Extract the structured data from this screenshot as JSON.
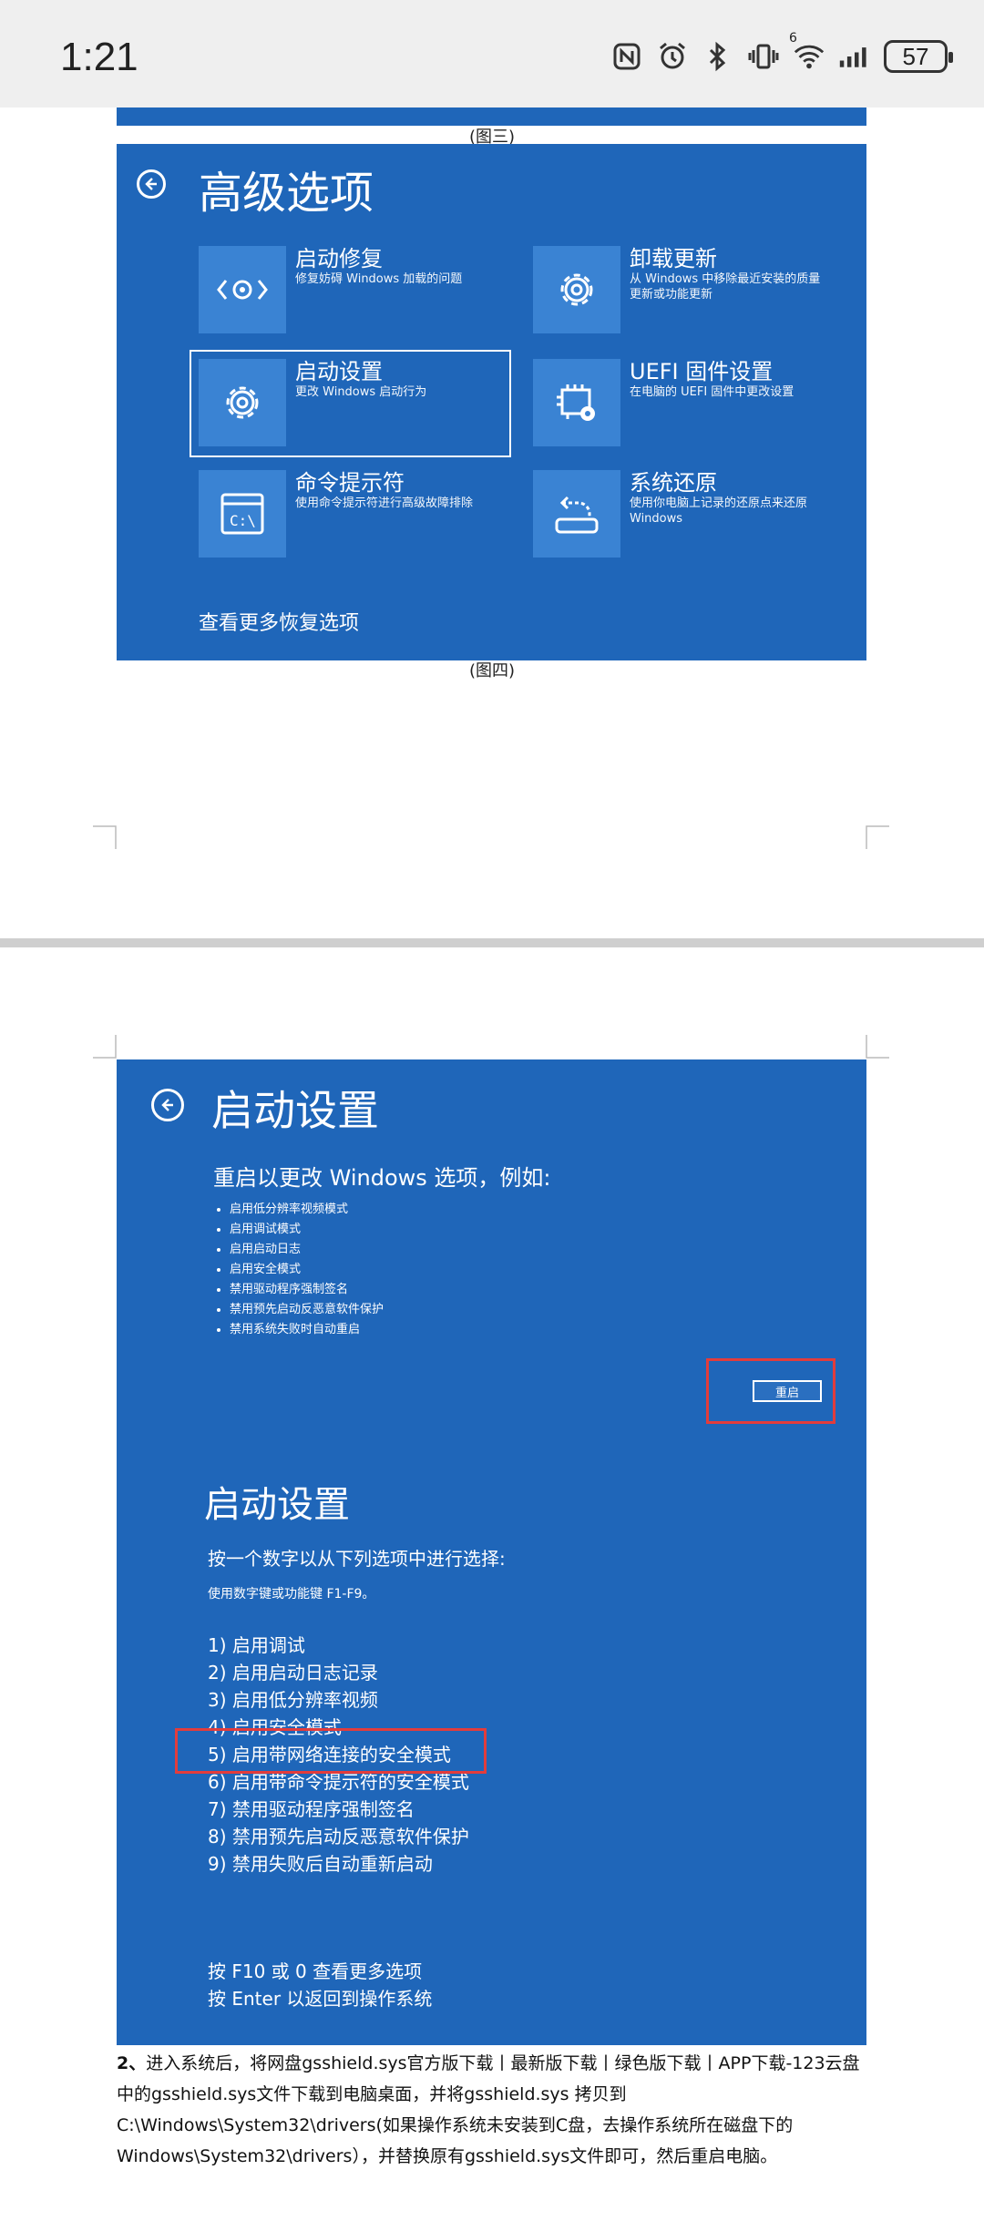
{
  "status": {
    "time": "1:21",
    "battery": "57",
    "net": "6"
  },
  "fig3_caption": "(图三)",
  "fig4_caption": "(图四)",
  "advanced": {
    "title": "高级选项",
    "options": [
      {
        "title": "启动修复",
        "desc": "修复妨碍 Windows 加载的问题",
        "icon": "startup-repair-icon"
      },
      {
        "title": "卸载更新",
        "desc": "从 Windows 中移除最近安装的质量更新或功能更新",
        "icon": "gear-icon"
      },
      {
        "title": "启动设置",
        "desc": "更改 Windows 启动行为",
        "icon": "gear-icon"
      },
      {
        "title": "UEFI 固件设置",
        "desc": "在电脑的 UEFI 固件中更改设置",
        "icon": "chip-gear-icon"
      },
      {
        "title": "命令提示符",
        "desc": "使用命令提示符进行高级故障排除",
        "icon": "cmd-icon"
      },
      {
        "title": "系统还原",
        "desc": "使用你电脑上记录的还原点来还原 Windows",
        "icon": "restore-icon"
      }
    ],
    "more": "查看更多恢复选项"
  },
  "startup": {
    "title": "启动设置",
    "subtitle": "重启以更改 Windows 选项，例如:",
    "bullets": [
      "启用低分辨率视频模式",
      "启用调试模式",
      "启用启动日志",
      "启用安全模式",
      "禁用驱动程序强制签名",
      "禁用预先启动反恶意软件保护",
      "禁用系统失败时自动重启"
    ],
    "restart": "重启",
    "title2": "启动设置",
    "prompt": "按一个数字以从下列选项中进行选择:",
    "hint": "使用数字键或功能键 F1-F9。",
    "options": [
      "1) 启用调试",
      "2) 启用启动日志记录",
      "3) 启用低分辨率视频",
      "4) 启用安全模式",
      "5) 启用带网络连接的安全模式",
      "6) 启用带命令提示符的安全模式",
      "7) 禁用驱动程序强制签名",
      "8) 禁用预先启动反恶意软件保护",
      "9) 禁用失败后自动重新启动"
    ],
    "footer1": "按 F10 或 0 查看更多选项",
    "footer2": "按 Enter 以返回到操作系统"
  },
  "paragraph": {
    "num": "2、",
    "text": "进入系统后，将网盘gsshield.sys官方版下载丨最新版下载丨绿色版下载丨APP下载-123云盘中的gsshield.sys文件下载到电脑桌面，并将gsshield.sys 拷贝到C:\\Windows\\System32\\drivers(如果操作系统未安装到C盘，去操作系统所在磁盘下的Windows\\System32\\drivers），并替换原有gsshield.sys文件即可，然后重启电脑。"
  }
}
